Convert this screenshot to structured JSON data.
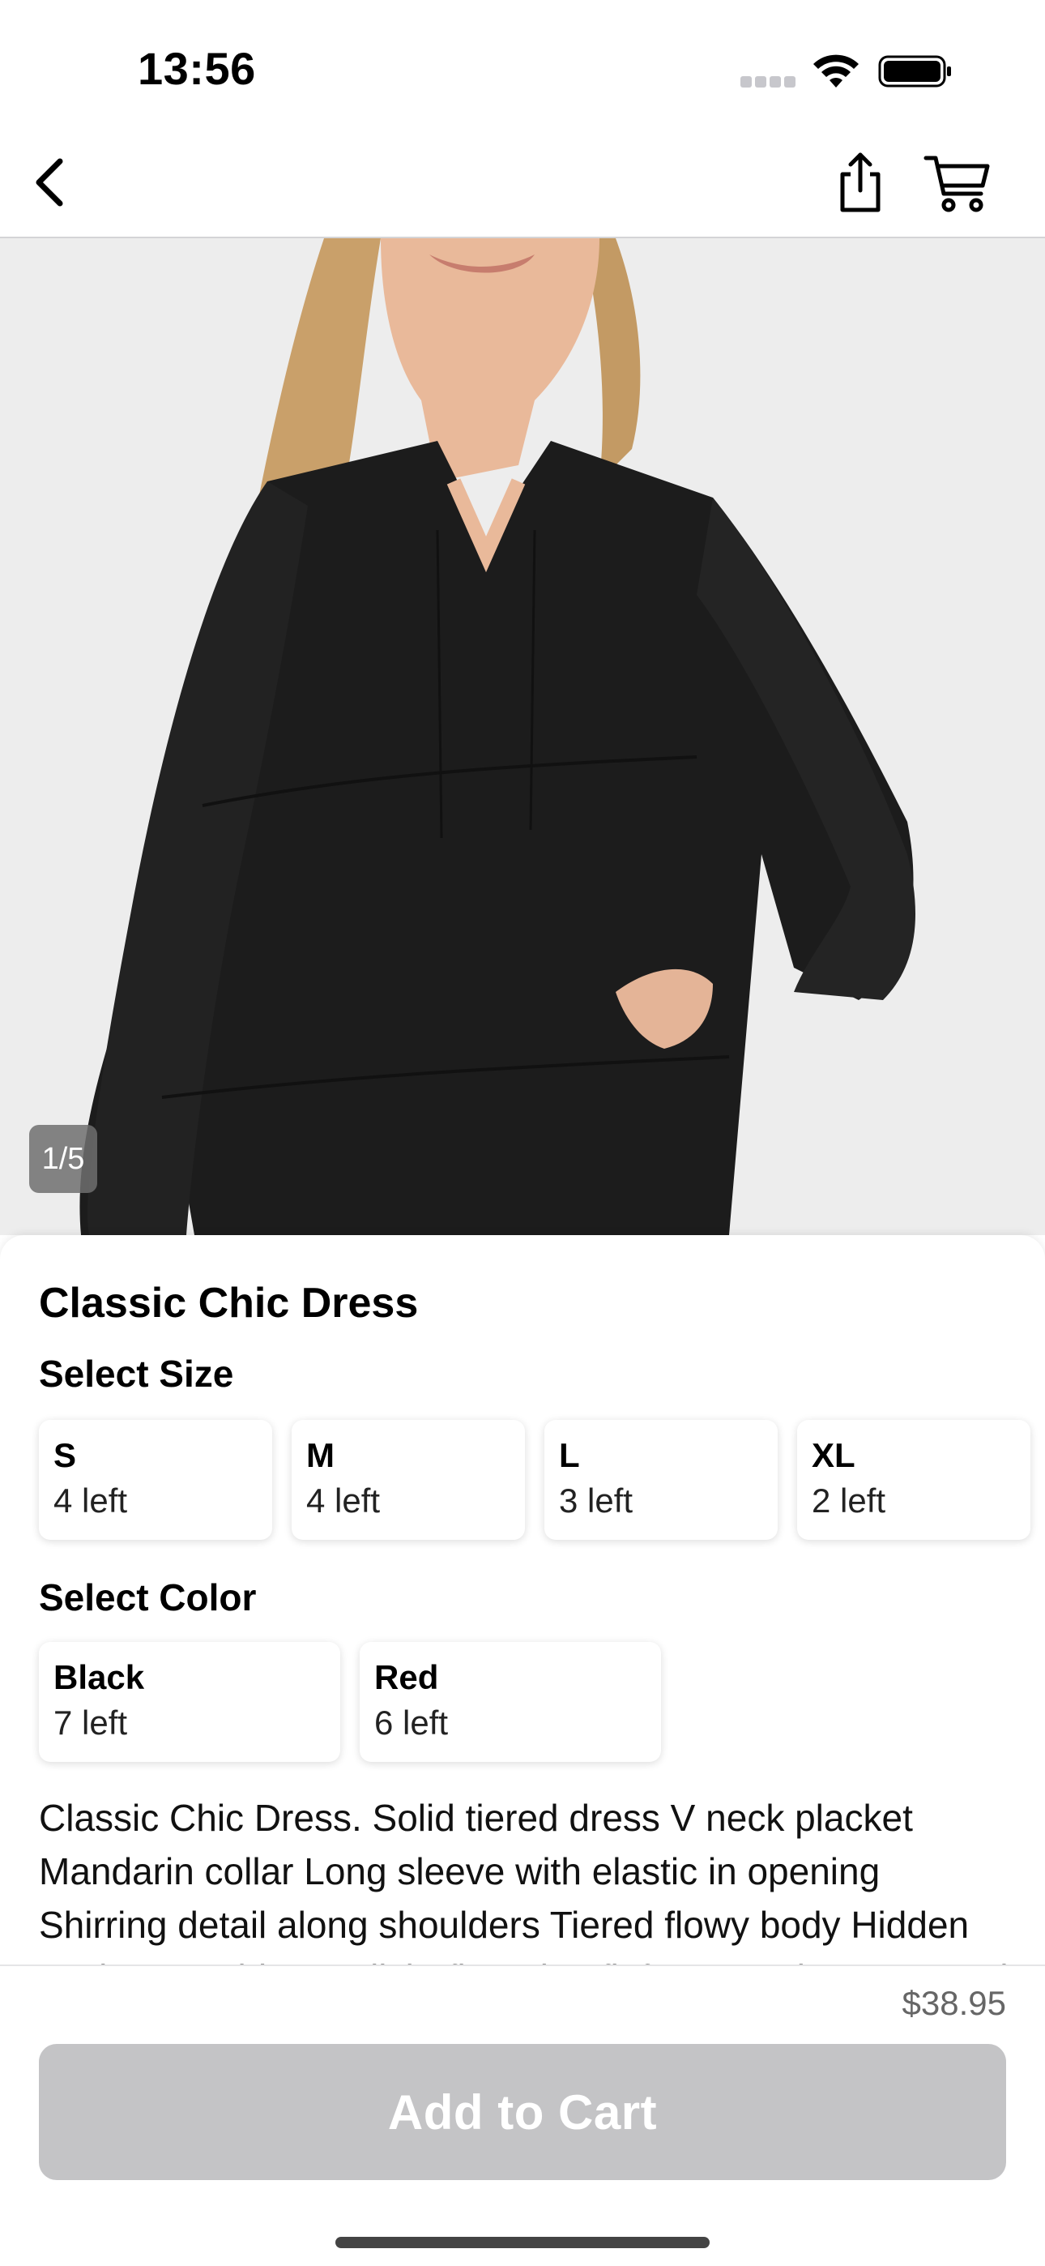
{
  "status_bar": {
    "time": "13:56",
    "icons": [
      "cellular-signal-icon",
      "wifi-icon",
      "battery-icon"
    ]
  },
  "nav": {
    "icons": [
      "chevron-left-icon",
      "share-icon",
      "cart-icon"
    ]
  },
  "gallery": {
    "counter": "1/5",
    "image_description_icon": "product-photo"
  },
  "product": {
    "title": "Classic Chic Dress",
    "size_label": "Select Size",
    "sizes": [
      {
        "name": "S",
        "stock": "4 left"
      },
      {
        "name": "M",
        "stock": "4 left"
      },
      {
        "name": "L",
        "stock": "3 left"
      },
      {
        "name": "XL",
        "stock": "2 left"
      }
    ],
    "color_label": "Select Color",
    "colors": [
      {
        "name": "Black",
        "stock": "7 left"
      },
      {
        "name": "Red",
        "stock": "6 left"
      }
    ],
    "description": "Classic Chic Dress. Solid tiered dress V neck placket Mandarin collar Long sleeve with elastic in opening Shirring detail along shoulders Tiered flowy body Hidden pockets at sides Stylish, flattering fit for everyday wear and special occasions."
  },
  "footer": {
    "price": "$38.95",
    "add_to_cart": "Add to Cart"
  },
  "colors": {
    "button_disabled": "#c4c4c6",
    "price_text": "#666666",
    "counter_bg": "#6e6e6e"
  }
}
